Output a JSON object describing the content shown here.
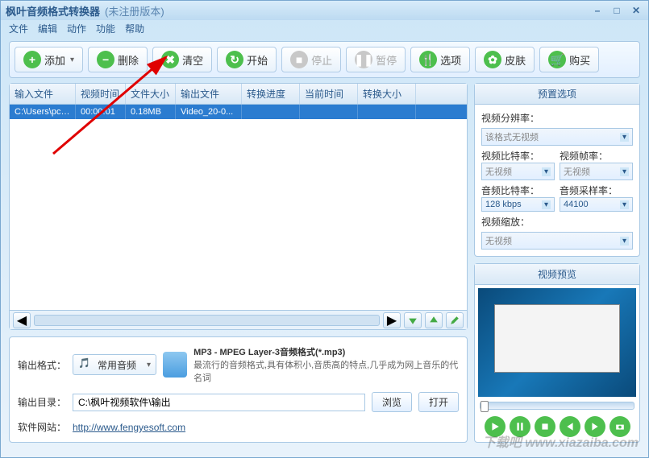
{
  "title": "枫叶音频格式转换器",
  "title_sub": "(未注册版本)",
  "menu": [
    "文件",
    "编辑",
    "动作",
    "功能",
    "帮助"
  ],
  "toolbar": {
    "add": "添加",
    "del": "删除",
    "clear": "清空",
    "start": "开始",
    "stop": "停止",
    "pause": "暂停",
    "options": "选项",
    "skin": "皮肤",
    "buy": "购买"
  },
  "grid": {
    "headers": [
      "输入文件",
      "视频时间",
      "文件大小",
      "输出文件",
      "转换进度",
      "当前时间",
      "转换大小"
    ],
    "row": [
      "C:\\Users\\pc\\...",
      "00:00:01",
      "0.18MB",
      "Video_20-0...",
      "",
      "",
      ""
    ]
  },
  "output": {
    "format_label": "输出格式：",
    "format_value": "常用音频",
    "desc_title": "MP3 - MPEG Layer-3音频格式(*.mp3)",
    "desc_body": "最流行的音频格式,具有体积小,音质高的特点,几乎成为网上音乐的代名词",
    "dir_label": "输出目录：",
    "dir_value": "C:\\枫叶视频软件\\输出",
    "browse": "浏览",
    "open": "打开",
    "site_label": "软件网站：",
    "site_url": "http://www.fengyesoft.com"
  },
  "presets": {
    "title": "预置选项",
    "res_label": "视频分辨率：",
    "res_value": "该格式无视频",
    "vbr_label": "视频比特率：",
    "vbr_value": "无视频",
    "fps_label": "视频帧率：",
    "fps_value": "无视频",
    "abr_label": "音频比特率：",
    "abr_value": "128 kbps",
    "asr_label": "音频采样率：",
    "asr_value": "44100",
    "zoom_label": "视频缩放：",
    "zoom_value": "无视频"
  },
  "preview": {
    "title": "视频预览"
  },
  "watermark": "下载吧 www.xiazaiba.com"
}
